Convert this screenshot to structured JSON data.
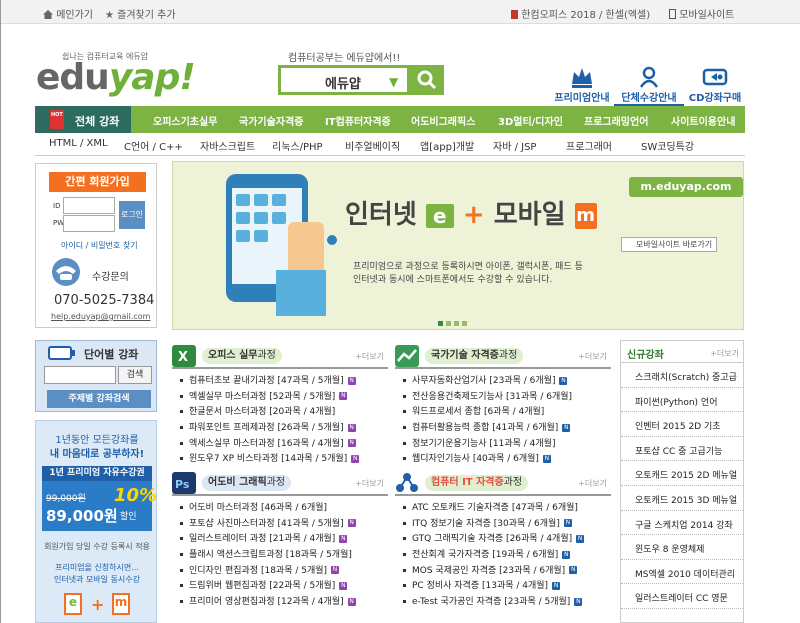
{
  "topbar": {
    "home": "메인가기",
    "favorite": "즐겨찾기 추가",
    "promo": "한컴오피스 2018 / 한셀(엑셀)",
    "mobile": "모바일사이트"
  },
  "header": {
    "tagline": "쉽나는 컴퓨터교육 에듀얍",
    "logo_edu": "edu",
    "logo_yap": "yap!",
    "search_caption": "컴퓨터공부는 에듀얍에서!!",
    "search_value": "에듀얍",
    "icons": [
      {
        "label": "프리미엄안내",
        "icon": "crown-icon"
      },
      {
        "label": "단체수강안내",
        "icon": "person-icon"
      },
      {
        "label": "CD강좌구매",
        "icon": "cd-icon"
      }
    ]
  },
  "nav": {
    "all": "전체 강좌",
    "hot": "HOT",
    "items": [
      "오피스기초실무",
      "국가기술자격증",
      "IT컴퓨터자격증",
      "어도비그래픽스",
      "3D멀티/디자인",
      "프로그래밍언어",
      "사이트이용안내"
    ],
    "sub": [
      "HTML / XML",
      "C언어 / C++",
      "자바스크립트",
      "리눅스/PHP",
      "비주얼베이직",
      "앱[app]개발",
      "자바 / JSP",
      "프로그래머",
      "SW코딩특강"
    ]
  },
  "login": {
    "join": "간편 회원가입",
    "id_label": "ID",
    "pw_label": "PW",
    "login_btn": "로그인",
    "find": "아이디 / 비밀번호 찾기",
    "inquiry": "수강문의",
    "phone": "070-5025-7384",
    "email": "help.eduyap@gmail.com"
  },
  "banner": {
    "url": "m.eduyap.com",
    "headline_a": "인터넷",
    "e": "e",
    "plus": "+",
    "headline_b": "모바일",
    "m": "m",
    "link": "모바일사이트 바로가기",
    "desc": [
      "프리미엄으로 과정으로 등록하시면 아이폰, 갤럭시폰, 패드 등",
      "인터넷과 동시에 스마트폰에서도 수강할 수 있습니다."
    ]
  },
  "word": {
    "title": "단어별 강좌",
    "search": "검색",
    "topic": "주제별 강좌검색"
  },
  "promo": {
    "line1": "1년동안 모든강좌를",
    "line2": "내 마음대로 공부하자!",
    "bar": "1년 프리미엄 자유수강권",
    "old_price": "99,000원",
    "new_price": "89,000원",
    "pct": "10%",
    "discount": "할인",
    "note": "회원가입 당일 수강 등록시 적용",
    "line3": "프리미엄을 신청하시면...",
    "line4": "인터넷과 모바일 동시수강",
    "e": "e",
    "plus": "+",
    "m": "m"
  },
  "panels": [
    {
      "title": "오피스 실무",
      "suffix": "과정",
      "more": "+더보기",
      "items": [
        "컴퓨터초보 끝내기과정 [47과목 / 5개월]",
        "엑셀실무 마스터과정 [52과목 / 5개월]",
        "한글문서 마스터과정 [20과목 / 4개월]",
        "파워포인트 프레제과정 [26과목 / 5개월]",
        "엑세스실무 마스터과정 [16과목 / 4개월]",
        "윈도우7 XP 비스타과정 [14과목 / 5개월]"
      ]
    },
    {
      "title": "국가기술 자격증",
      "suffix": "과정",
      "more": "+더보기",
      "items": [
        "사무자동화산업기사 [23과목 / 6개월]",
        "전산응용건축제도기능사 [31과목 / 6개월]",
        "워드프로세서 종합 [6과목 / 4개월]",
        "컴퓨터활용능력 종합 [41과목 / 6개월]",
        "정보기기운용기능사 [11과목 / 4개월]",
        "웹디자인기능사 [40과목 / 6개월]"
      ]
    },
    {
      "title": "어도비 그래픽",
      "suffix": "과정",
      "more": "+더보기",
      "items": [
        "어도비 마스터과정 [46과목 / 6개월]",
        "포토샵 사진마스터과정 [41과목 / 5개월]",
        "일러스트레이터 과정 [21과목 / 4개월]",
        "플래시 액션스크립트과정 [18과목 / 5개월]",
        "인디자인 편집과정 [18과목 / 5개월]",
        "드림위버 웹편집과정 [22과목 / 5개월]",
        "프리미어 영상편집과정 [12과목 / 4개월]"
      ]
    },
    {
      "title": "컴퓨터 IT 자격증",
      "suffix": "과정",
      "more": "+더보기",
      "items": [
        "ATC 오토캐드 기술자격증 [47과목 / 6개월]",
        "ITQ 정보기술 자격증 [30과목 / 6개월]",
        "GTQ 그래픽기술 자격증 [26과목 / 4개월]",
        "전산회계 국가자격증 [19과목 / 6개월]",
        "MOS 국제공인 자격증 [23과목 / 6개월]",
        "PC 정비사 자격증 [13과목 / 4개월]",
        "e-Test 국가공인 자격증 [23과목 / 5개월]"
      ]
    }
  ],
  "newcourse": {
    "title": "신규강좌",
    "more": "+더보기",
    "items": [
      "스크래치(Scratch) 중고급",
      "파이썬(Python) 언어",
      "인벤터 2015 2D 기초",
      "포토샵 CC 중 고급기능",
      "오토캐드 2015 2D 메뉴얼",
      "오토캐드 2015 3D 메뉴얼",
      "구글 스케치업 2014 강좌",
      "윈도우 8 운영체제",
      "MS엑셀 2010 데이터관리",
      "일러스트레이터 CC 영문"
    ]
  },
  "colors": {
    "green": "#7cb342",
    "dark_green": "#2d6b5f",
    "orange": "#f37021",
    "blue": "#1f5fa8"
  }
}
